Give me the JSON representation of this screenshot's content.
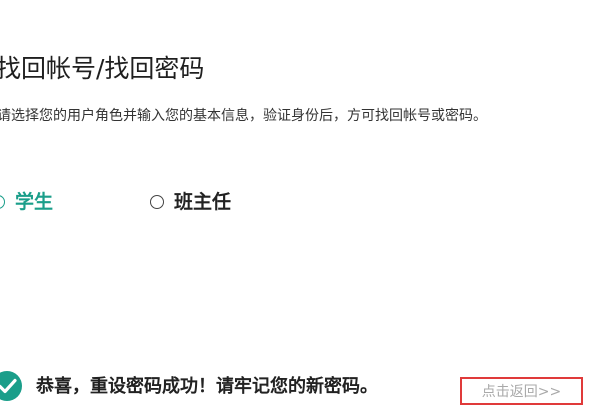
{
  "page": {
    "title": "找回帐号/找回密码",
    "instructions": "请选择您的用户角色并输入您的基本信息，验证身份后，方可找回帐号或密码。"
  },
  "roles": {
    "student": {
      "label": "学生",
      "selected": true
    },
    "teacher": {
      "label": "班主任",
      "selected": false
    }
  },
  "result": {
    "icon": "check-circle-icon",
    "message": "恭喜，重设密码成功！请牢记您的新密码。",
    "back_link": "点击返回>>"
  },
  "colors": {
    "accent": "#1a9e8a",
    "back_link_border": "#e03a3a",
    "back_link_text": "#a9a9a9"
  }
}
